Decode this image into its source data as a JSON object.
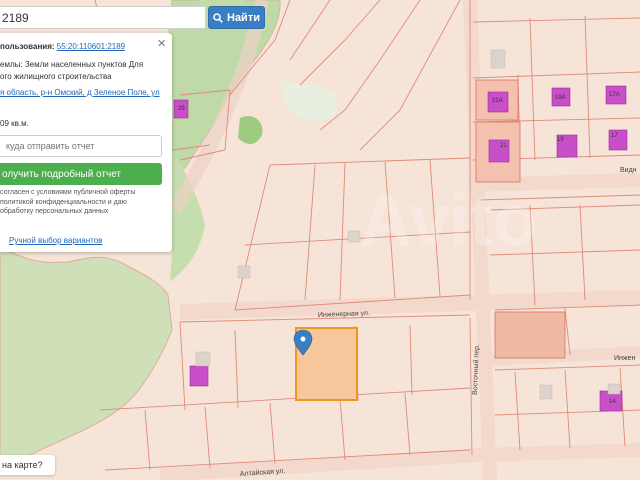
{
  "search": {
    "value": "2189",
    "button_label": "Найти"
  },
  "panel": {
    "usage_label": "пользования:",
    "cadastral_number": "55:20:110601:2189",
    "category_line1": "емлы: Земли населенных пунктов Для",
    "category_line2": "ого жилищного строительства",
    "address": "я область, р-н Омский, д Зеленое Поле, ул",
    "area": "09 кв.м.",
    "email_placeholder": "куда отправить отчет",
    "report_button": "олучить подробный отчет",
    "terms_line1": "согласен с условиями публичной оферты",
    "terms_line2": "политикой конфиденциальности и даю",
    "terms_line3": "обработку персональных данных",
    "manual_link": "Ручной выбор вариантов"
  },
  "map_hint": "на карте?",
  "streets": {
    "inzhenernaya": "Инженерная ул.",
    "vostochny": "Восточный пер.",
    "altayskaya": "Алтайская ул.",
    "inzhener_right": "Инжен",
    "vidn": "Видн"
  },
  "plot_labels": [
    "21А",
    "21",
    "19",
    "19А",
    "17А",
    "17",
    "29",
    "14"
  ],
  "colors": {
    "accent": "#3a7fc4",
    "report": "#4cae4c",
    "selected_plot": "#f3b27f",
    "marker": "#3a7fc4",
    "building": "#c84fc8"
  },
  "icons": {
    "search": "search-icon",
    "close": "close-icon",
    "marker": "map-marker-icon"
  }
}
